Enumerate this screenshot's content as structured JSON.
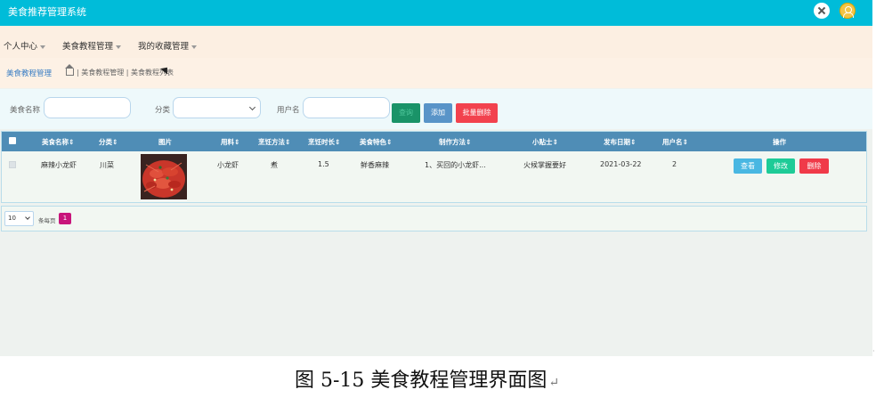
{
  "app": {
    "title": "美食推荐管理系统"
  },
  "header": {
    "close_icon": "close-icon",
    "avatar_icon": "user-avatar-icon"
  },
  "nav": {
    "items": [
      {
        "label": "个人中心"
      },
      {
        "label": "美食教程管理"
      },
      {
        "label": "我的收藏管理"
      }
    ]
  },
  "breadcrumb": {
    "title": "美食教程管理",
    "trail": "| 美食教程管理 | 美食教程列表"
  },
  "search": {
    "food_name_label": "美食名称",
    "food_name_value": "",
    "category_label": "分类",
    "category_value": "",
    "username_label": "用户名",
    "username_value": "",
    "search_button": "查询",
    "add_button": "添加",
    "batch_delete_button": "批量删除"
  },
  "table": {
    "columns": [
      "美食名称⇕",
      "分类⇕",
      "图片",
      "用料⇕",
      "烹饪方法⇕",
      "烹饪时长⇕",
      "美食特色⇕",
      "制作方法⇕",
      "小贴士⇕",
      "发布日期⇕",
      "用户名⇕",
      "操作"
    ],
    "rows": [
      {
        "name": "麻辣小龙虾",
        "category": "川菜",
        "image_icon": "crayfish-photo",
        "ingredients": "小龙虾",
        "method": "煮",
        "duration": "1.5",
        "feature": "鲜香麻辣",
        "steps": "1、买回的小龙虾...",
        "tips": "火候掌握要好",
        "date": "2021-03-22",
        "username": "2",
        "view_label": "查看",
        "edit_label": "修改",
        "delete_label": "删除"
      }
    ]
  },
  "pager": {
    "page_size": "10",
    "total_text": "条每页",
    "current_page": "1"
  },
  "caption": {
    "text": "图 5-15 美食教程管理界面图",
    "return_mark": "↵"
  },
  "colors": {
    "header": "#00bcd9",
    "nav": "#fcefe2",
    "table_header": "#4f8db6",
    "search_button": "#1a9368",
    "add_button": "#5994c8",
    "delete_button": "#f2424e",
    "page_active": "#c8157b"
  }
}
